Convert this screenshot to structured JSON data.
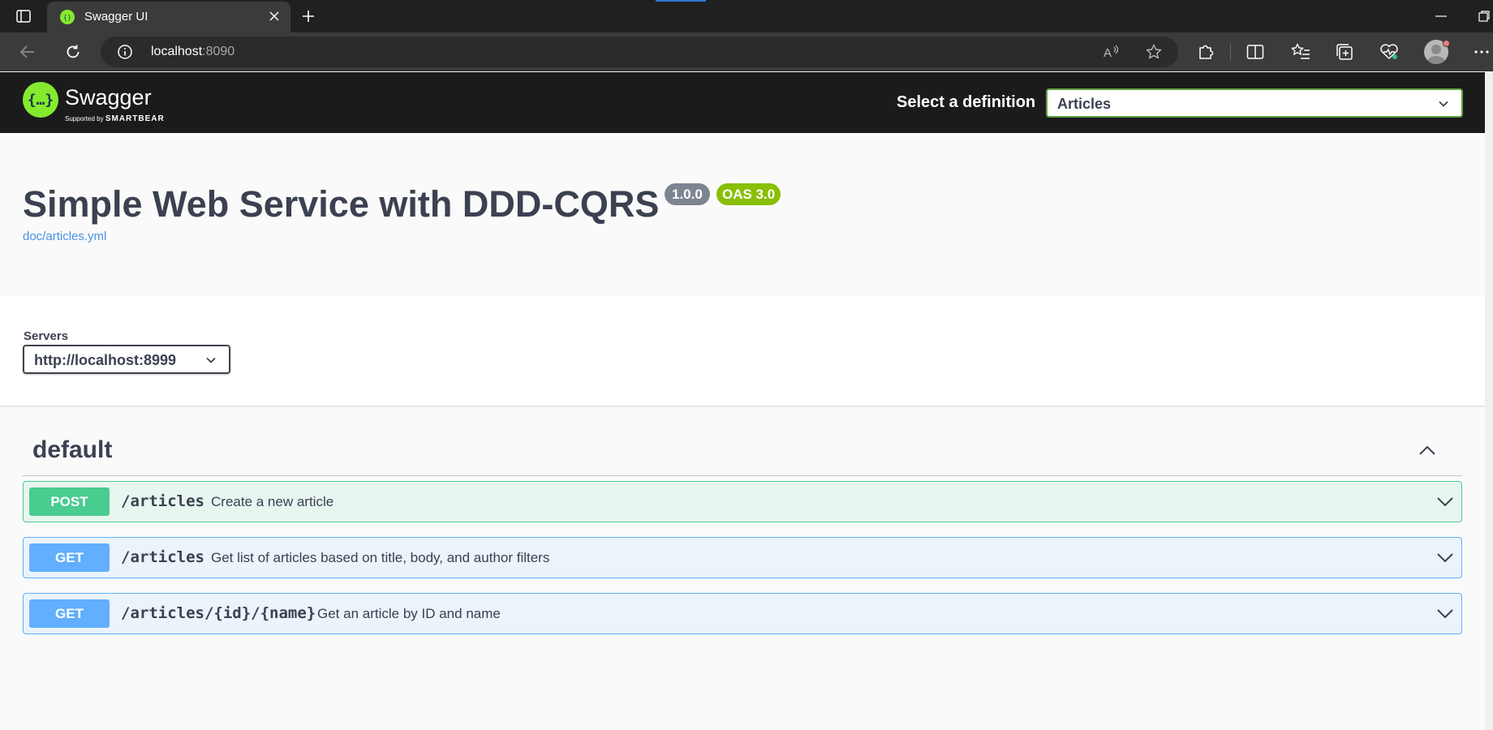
{
  "browser": {
    "tab_title": "Swagger UI",
    "url_host": "localhost",
    "url_port": ":8090"
  },
  "swagger": {
    "brand": "Swagger",
    "brand_supported_by": "Supported by",
    "brand_company": "SMARTBEAR",
    "select_definition_label": "Select a definition",
    "definition_value": "Articles",
    "title": "Simple Web Service with DDD-CQRS",
    "version_badge": "1.0.0",
    "oas_badge": "OAS 3.0",
    "spec_link": "doc/articles.yml",
    "servers_label": "Servers",
    "server_value": "http://localhost:8999",
    "tag_name": "default",
    "operations": [
      {
        "method": "POST",
        "path": "/articles",
        "summary": "Create a new article"
      },
      {
        "method": "GET",
        "path": "/articles",
        "summary": "Get list of articles based on title, body, and author filters"
      },
      {
        "method": "GET",
        "path": "/articles/{id}/{name}",
        "summary": "Get an article by ID and name"
      }
    ]
  },
  "colors": {
    "swagger_green": "#85ea2d",
    "post_green": "#49cc90",
    "get_blue": "#61affe",
    "topbar_dark": "#1b1b1b",
    "text_dark": "#3b4151",
    "oas_badge": "#89bf04",
    "version_badge": "#7d8492"
  },
  "icons": {
    "tab_sidebar": "sidebar-layout-icon",
    "favicon": "swagger-logo-icon",
    "close": "close-icon",
    "new_tab": "plus-icon",
    "back": "arrow-left-icon",
    "refresh": "refresh-icon",
    "info": "info-circle-icon",
    "read_aloud": "read-aloud-icon",
    "favorite": "star-icon",
    "extensions": "puzzle-icon",
    "split_screen": "split-screen-icon",
    "favorites": "favorites-list-icon",
    "collections": "collections-icon",
    "health": "heartbeat-icon",
    "profile": "profile-avatar-icon",
    "more": "ellipsis-icon",
    "chevron_down": "chevron-down-icon",
    "chevron_up": "chevron-up-icon"
  }
}
